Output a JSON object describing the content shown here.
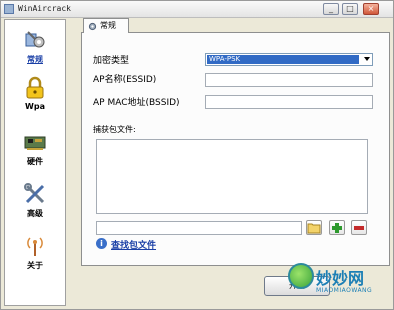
{
  "window": {
    "title": "WinAircrack",
    "buttons": {
      "minimize": "_",
      "maximize": "□",
      "close": "×"
    }
  },
  "sidebar": {
    "items": [
      {
        "label": "常规",
        "icon": "wrench-cog-icon"
      },
      {
        "label": "Wpa",
        "icon": "padlock-icon"
      },
      {
        "label": "硬件",
        "icon": "hardware-card-icon"
      },
      {
        "label": "高级",
        "icon": "tools-icon"
      },
      {
        "label": "关于",
        "icon": "antenna-icon"
      }
    ]
  },
  "tab": {
    "label": "常规"
  },
  "form": {
    "encryption_label": "加密类型",
    "encryption_value": "WPA-PSK",
    "essid_label": "AP名称(ESSID)",
    "essid_value": "",
    "bssid_label": "AP MAC地址(BSSID)",
    "bssid_value": "",
    "capture_label": "捕获包文件:",
    "capture_path": "",
    "find_link": "查找包文件"
  },
  "bottom_button": {
    "label": "开始"
  },
  "watermark": {
    "text": "妙妙网",
    "sub": "MIAOMIAOWANG"
  },
  "colors": {
    "accent": "#316ac5",
    "link": "#1a3fa6",
    "panel_bg": "#fcfcfc",
    "window_bg": "#ece9d8"
  }
}
